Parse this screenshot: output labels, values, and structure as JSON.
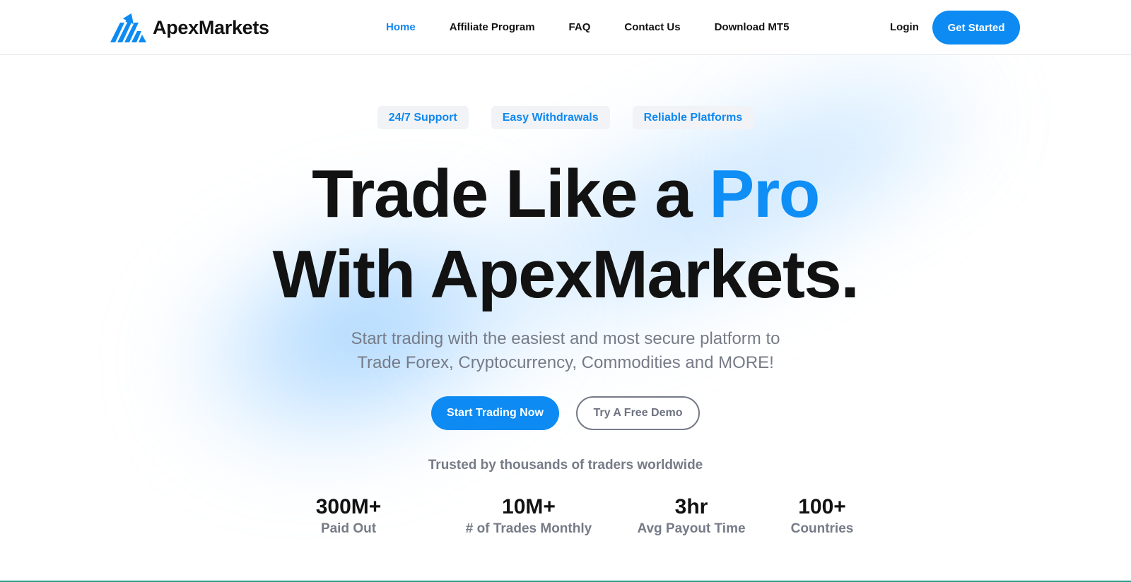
{
  "brand": {
    "name": "ApexMarkets",
    "logo_icon": "mountain-chart-logo-icon"
  },
  "nav": {
    "links": [
      {
        "label": "Home",
        "active": true
      },
      {
        "label": "Affiliate Program",
        "active": false
      },
      {
        "label": "FAQ",
        "active": false
      },
      {
        "label": "Contact Us",
        "active": false
      },
      {
        "label": "Download MT5",
        "active": false
      }
    ],
    "login_label": "Login",
    "get_started_label": "Get Started"
  },
  "hero": {
    "chips": [
      "24/7 Support",
      "Easy Withdrawals",
      "Reliable Platforms"
    ],
    "headline": {
      "line1_prefix": "Trade Like a ",
      "line1_accent": "Pro",
      "line2": "With ApexMarkets."
    },
    "subtext_line1": "Start trading with the easiest and most secure platform to",
    "subtext_line2": "Trade Forex, Cryptocurrency, Commodities and MORE!",
    "primary_cta": "Start Trading Now",
    "secondary_cta": "Try A Free Demo",
    "trusted_text": "Trusted by thousands of traders worldwide"
  },
  "stats": [
    {
      "value": "300M+",
      "label": "Paid Out"
    },
    {
      "value": "10M+",
      "label": "# of Trades Monthly"
    },
    {
      "value": "3hr",
      "label": "Avg Payout Time"
    },
    {
      "value": "100+",
      "label": "Countries"
    }
  ],
  "colors": {
    "accent": "#0d8bf2",
    "text": "#121212",
    "muted": "#767b87",
    "chip_bg": "#f1f3f6"
  }
}
